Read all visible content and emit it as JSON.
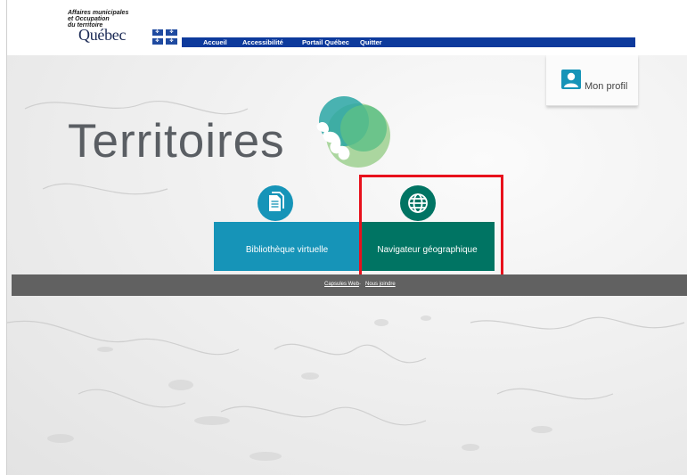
{
  "header": {
    "ministry_line1": "Affaires municipales",
    "ministry_line2": "et Occupation",
    "ministry_line3": "du territoire",
    "quebec_word": "Québec",
    "nav": [
      {
        "label": "Accueil"
      },
      {
        "label": "Accessibilité"
      },
      {
        "label": "Portail Québec"
      },
      {
        "label": "Quitter"
      }
    ]
  },
  "profile": {
    "label": "Mon profil",
    "icon": "user-icon"
  },
  "brand": {
    "title": "Territoires"
  },
  "tiles": [
    {
      "label": "Bibliothèque virtuelle",
      "icon": "document-icon",
      "color": "#1694b8"
    },
    {
      "label": "Navigateur géographique",
      "icon": "globe-icon",
      "color": "#007463"
    }
  ],
  "footer": {
    "links": [
      {
        "label": "Capsules Web"
      },
      {
        "label": "Nous joindre"
      }
    ],
    "separator": "-"
  },
  "colors": {
    "nav_blue": "#0d3a9c",
    "highlight_red": "#e8111c",
    "footer_gray": "#616161"
  }
}
